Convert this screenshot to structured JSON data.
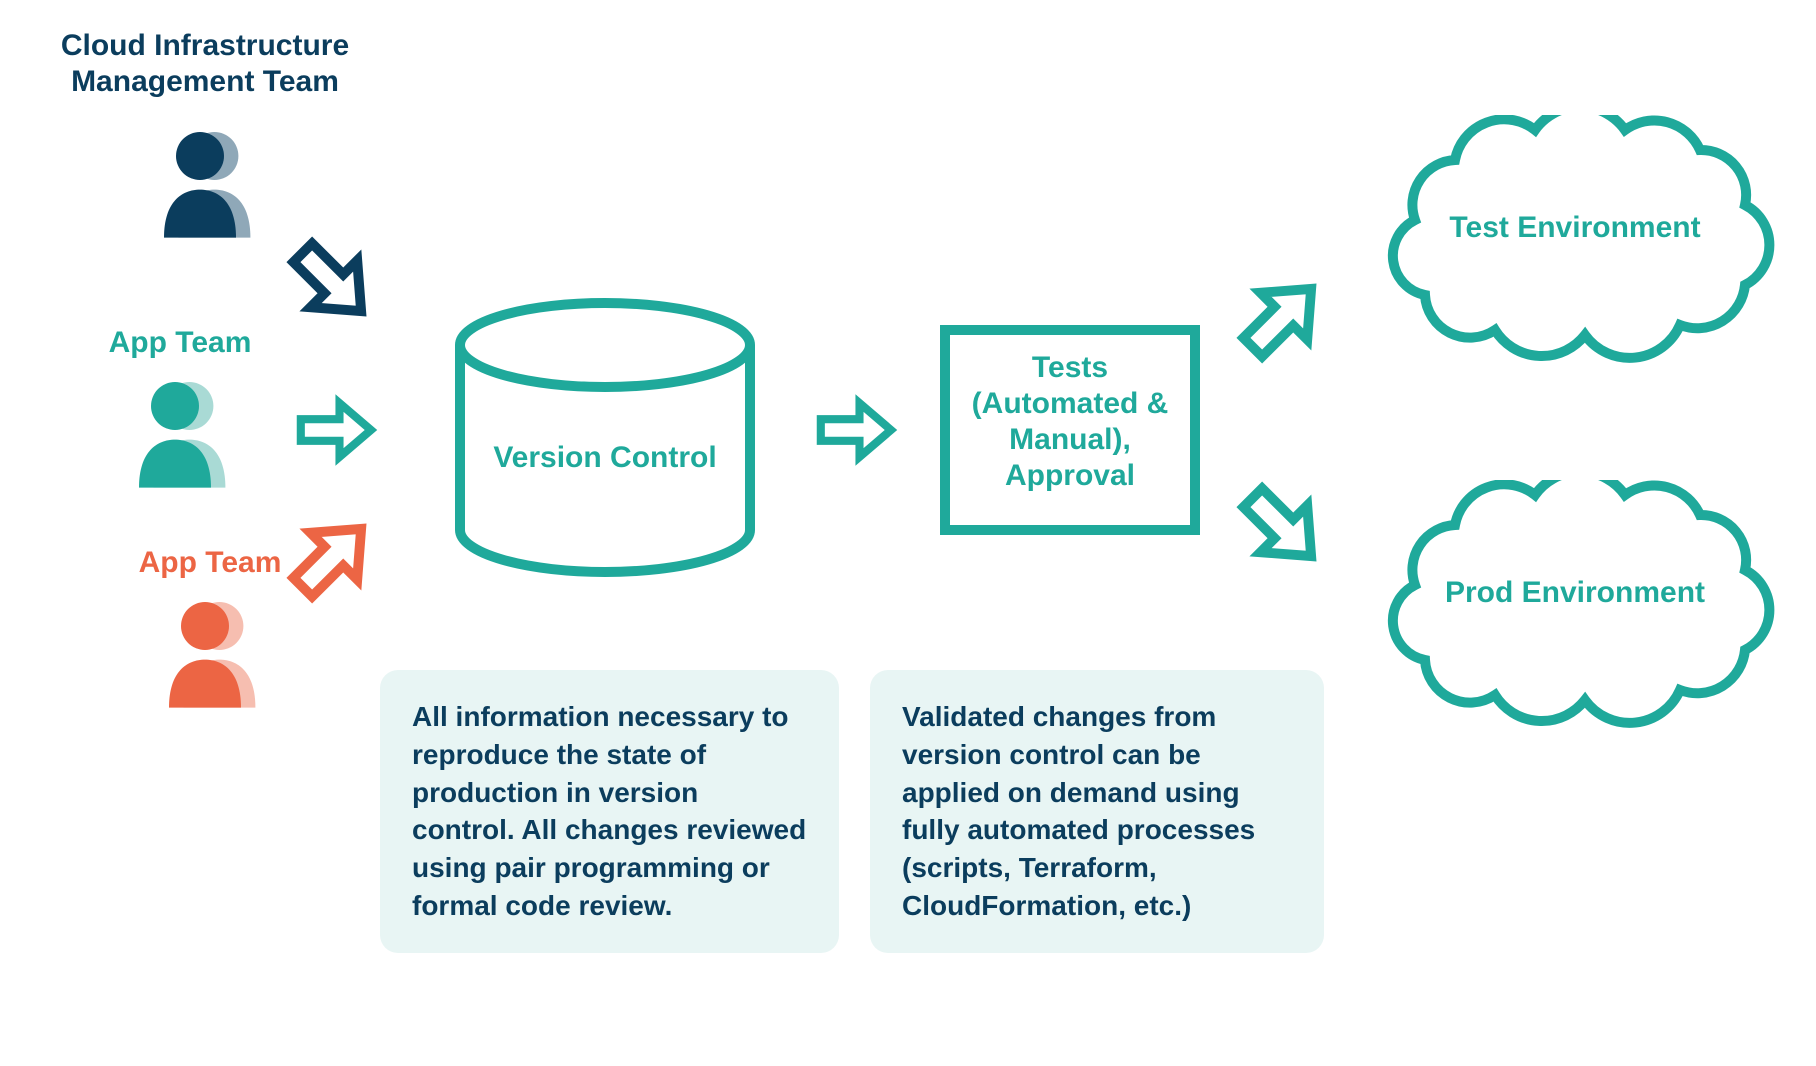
{
  "teams": {
    "cloud_infra": "Cloud Infrastructure Management Team",
    "app_team_1": "App Team",
    "app_team_2": "App Team"
  },
  "nodes": {
    "version_control": "Version Control",
    "tests": "Tests (Automated & Manual), Approval",
    "test_env": "Test Environment",
    "prod_env": "Prod Environment"
  },
  "notes": {
    "left": "All information necessary to reproduce the state of production in version control. All changes reviewed using pair programming or formal code review.",
    "right": "Validated changes from version control can be applied on demand using fully automated processes (scripts, Terraform, CloudFormation, etc.)"
  },
  "colors": {
    "navy": "#0B3D5D",
    "teal": "#1FA99B",
    "orange": "#EC6544",
    "lightTeal": "#A9DAD5",
    "lightNavy": "#8FA8B8",
    "lightOrange": "#F6BEB0",
    "boxBg": "#E8F5F4"
  }
}
